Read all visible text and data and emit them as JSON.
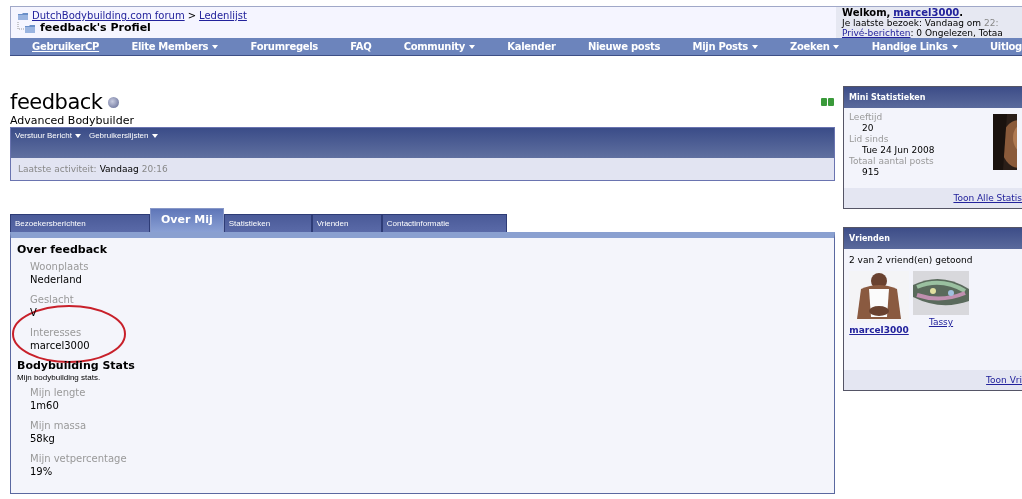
{
  "breadcrumb": {
    "links": [
      "DutchBodybuilding.com forum",
      "Ledenlijst"
    ],
    "separator": ">",
    "title": "feedback's Profiel"
  },
  "welcome": {
    "greeting": "Welkom,",
    "user": "marcel3000",
    "period": ".",
    "last_visit_label": "Je laatste bezoek: Vandaag om",
    "last_visit_time": "22:",
    "pm_link": "Privé-berichten",
    "pm_text": ": 0 Ongelezen, Totaa"
  },
  "nav": [
    {
      "label": "GebruikerCP",
      "menu": false,
      "link": true
    },
    {
      "label": "Elite Members",
      "menu": true,
      "link": false
    },
    {
      "label": "Forumregels",
      "menu": false,
      "link": false
    },
    {
      "label": "FAQ",
      "menu": false,
      "link": false
    },
    {
      "label": "Community",
      "menu": true,
      "link": false
    },
    {
      "label": "Kalender",
      "menu": false,
      "link": false
    },
    {
      "label": "Nieuwe posts",
      "menu": false,
      "link": false
    },
    {
      "label": "Mijn Posts",
      "menu": true,
      "link": false
    },
    {
      "label": "Zoeken",
      "menu": true,
      "link": false
    },
    {
      "label": "Handige Links",
      "menu": true,
      "link": false
    },
    {
      "label": "Uitlog",
      "menu": false,
      "link": false
    }
  ],
  "profile": {
    "name": "feedback",
    "online": false,
    "rank": "Advanced Bodybuilder",
    "actions": [
      {
        "label": "Verstuur Bericht"
      },
      {
        "label": "Gebruikerslijsten"
      }
    ],
    "activity_label": "Laatste activiteit:",
    "activity_day": "Vandaag",
    "activity_time": "20:16"
  },
  "tabs": [
    {
      "label": "Bezoekersberichten",
      "selected": false
    },
    {
      "label": "Over Mij",
      "selected": true
    },
    {
      "label": "Statistieken",
      "selected": false
    },
    {
      "label": "Vrienden",
      "selected": false
    },
    {
      "label": "Contactinformatie",
      "selected": false
    }
  ],
  "sections": [
    {
      "title": "Over feedback",
      "fields": [
        {
          "label": "Woonplaats",
          "value": "Nederland"
        },
        {
          "label": "Geslacht",
          "value": "V"
        },
        {
          "label": "Interesses",
          "value": "marcel3000"
        }
      ]
    },
    {
      "title": "Bodybuilding Stats",
      "description": "Mijn bodybuilding stats.",
      "fields": [
        {
          "label": "Mijn lengte",
          "value": "1m60"
        },
        {
          "label": "Mijn massa",
          "value": "58kg"
        },
        {
          "label": "Mijn vetpercentage",
          "value": "19%"
        }
      ]
    }
  ],
  "mini_stats": {
    "title": "Mini Statistieken",
    "items": [
      {
        "label": "Leeftijd",
        "value": "20"
      },
      {
        "label": "Lid sinds",
        "value": "Tue 24 Jun 2008"
      },
      {
        "label": "Totaal aantal posts",
        "value": "915"
      }
    ],
    "footer_link": "Toon Alle Statis"
  },
  "friends": {
    "title": "Vrienden",
    "count_text": "2 van 2 vriend(en) getoond",
    "items": [
      {
        "name": "marcel3000",
        "bold": true
      },
      {
        "name": "Tassy",
        "bold": false
      }
    ],
    "footer_link": "Toon Vri"
  }
}
